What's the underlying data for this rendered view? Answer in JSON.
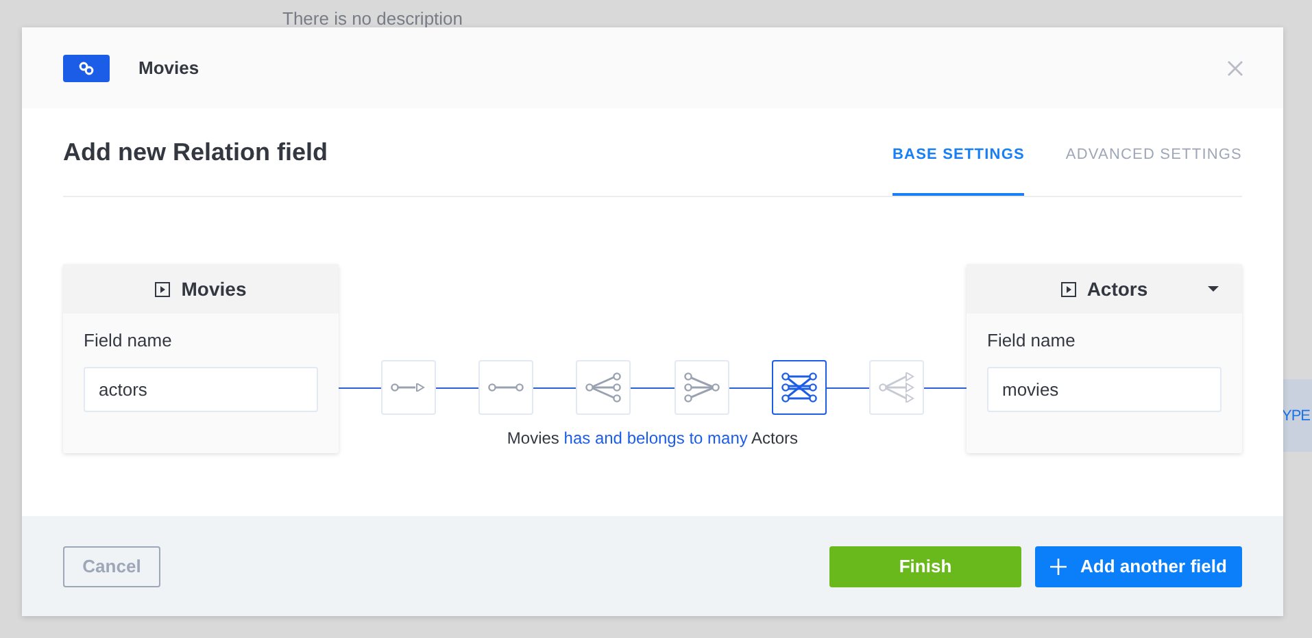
{
  "background": {
    "description": "There is no description",
    "edge_button": "YPE"
  },
  "modal": {
    "header_title": "Movies",
    "title": "Add new Relation field",
    "tabs": [
      {
        "label": "BASE SETTINGS",
        "selected": true
      },
      {
        "label": "ADVANCED SETTINGS",
        "selected": false
      }
    ],
    "cards": [
      {
        "kind": "fixed",
        "name": "Movies",
        "field_label": "Field name",
        "value": "actors"
      },
      {
        "kind": "select",
        "name": "Actors",
        "field_label": "Field name",
        "value": "movies"
      }
    ],
    "relations": [
      {
        "kind": "one-way",
        "selected": false,
        "disabled": false
      },
      {
        "kind": "one-to-one",
        "selected": false,
        "disabled": false
      },
      {
        "kind": "one-to-many",
        "selected": false,
        "disabled": false
      },
      {
        "kind": "many-to-one",
        "selected": false,
        "disabled": false
      },
      {
        "kind": "many-to-many",
        "selected": true,
        "disabled": false
      },
      {
        "kind": "many-way",
        "selected": false,
        "disabled": true
      }
    ],
    "caption": {
      "source": "Movies",
      "relation": "has and belongs to many",
      "target": "Actors"
    },
    "buttons": {
      "cancel": "Cancel",
      "finish": "Finish",
      "add": "Add another field"
    }
  }
}
